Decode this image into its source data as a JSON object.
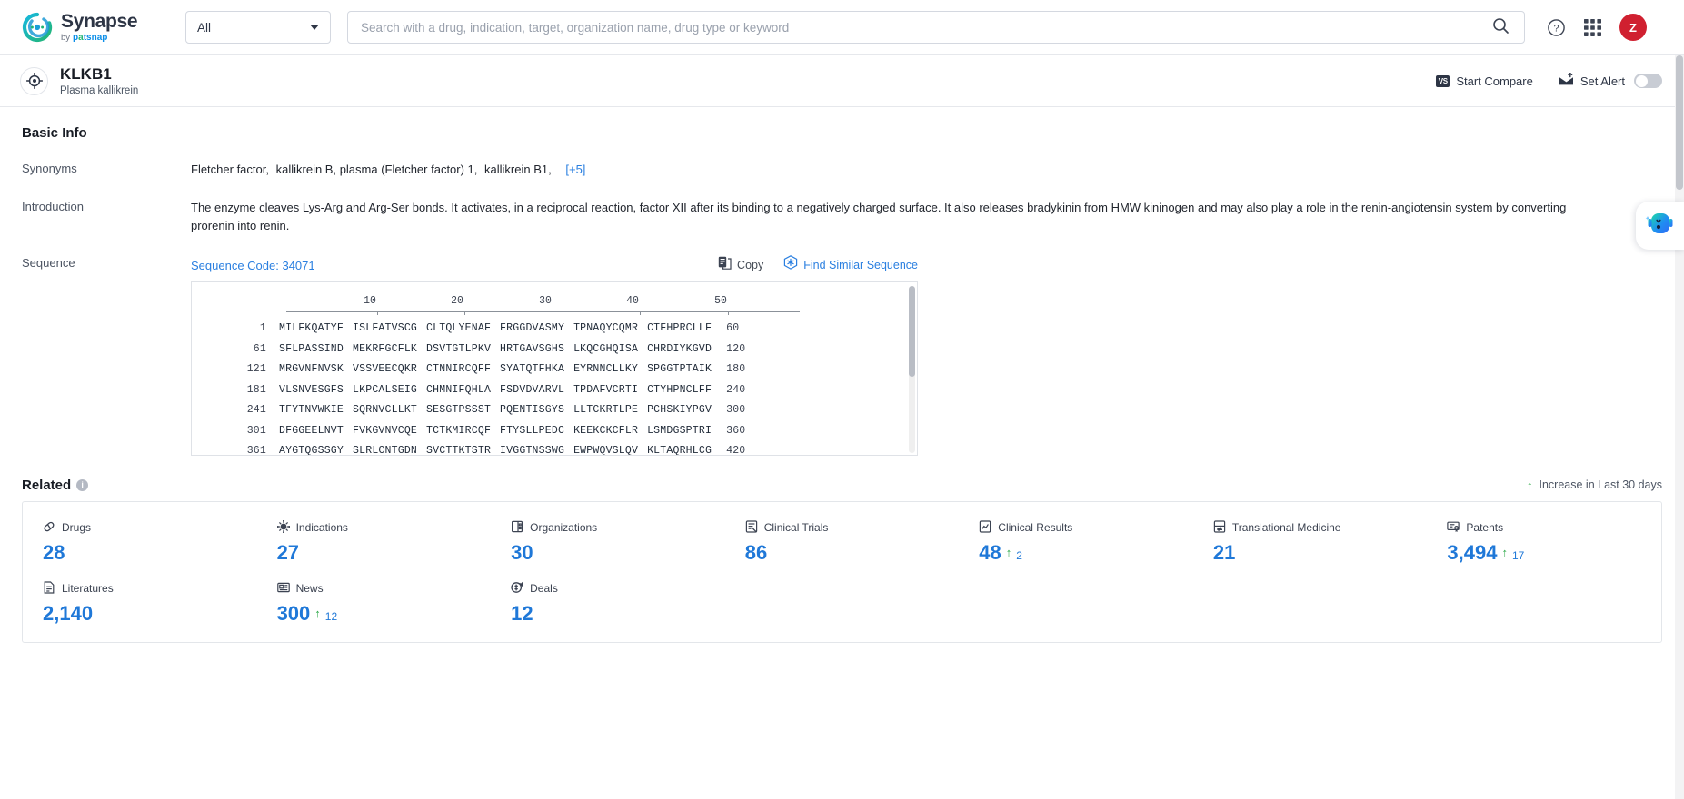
{
  "topbar": {
    "logo": {
      "title": "Synapse",
      "by": "by",
      "brand": "patsnap",
      "icon": "synapse-logo-icon"
    },
    "scope": {
      "value": "All",
      "options": [
        "All"
      ]
    },
    "search": {
      "value": "",
      "placeholder": "Search with a drug, indication, target, organization name, drug type or keyword",
      "icon": "search-icon"
    },
    "help_icon": "help-circle-icon",
    "apps_icon": "apps-grid-icon",
    "avatar_initial": "Z"
  },
  "entitybar": {
    "icon": "target-icon",
    "title": "KLKB1",
    "subtitle": "Plasma kallikrein",
    "start_compare": {
      "label": "Start Compare",
      "badge": "VS",
      "icon": "vs-icon"
    },
    "set_alert": {
      "label": "Set Alert",
      "icon": "alert-mail-icon",
      "enabled": false
    }
  },
  "basic_info": {
    "title": "Basic Info",
    "synonyms": {
      "label": "Synonyms",
      "items": [
        "Fletcher factor,",
        "kallikrein B, plasma (Fletcher factor) 1,",
        "kallikrein B1,"
      ],
      "more": "[+5]"
    },
    "introduction": {
      "label": "Introduction",
      "text": "The enzyme cleaves Lys-Arg and Arg-Ser bonds. It activates, in a reciprocal reaction, factor XII after its binding to a negatively charged surface. It also releases bradykinin from HMW kininogen and may also play a role in the renin-angiotensin system by converting prorenin into renin."
    },
    "sequence": {
      "label": "Sequence",
      "code_label": "Sequence Code: 34071",
      "copy_label": "Copy",
      "copy_icon": "copy-icon",
      "find_label": "Find Similar Sequence",
      "find_icon": "find-similar-icon",
      "ruler_ticks": [
        10,
        20,
        30,
        40,
        50
      ],
      "lines": [
        {
          "start": "1",
          "chunks": [
            "MILFKQATYF",
            "ISLFATVSCG",
            "CLTQLYENAF",
            "FRGGDVASMY",
            "TPNAQYCQMR",
            "CTFHPRCLLF"
          ],
          "end": "60"
        },
        {
          "start": "61",
          "chunks": [
            "SFLPASSIND",
            "MEKRFGCFLK",
            "DSVTGTLPKV",
            "HRTGAVSGHS",
            "LKQCGHQISA",
            "CHRDIYKGVD"
          ],
          "end": "120"
        },
        {
          "start": "121",
          "chunks": [
            "MRGVNFNVSK",
            "VSSVEECQKR",
            "CTNNIRCQFF",
            "SYATQTFHKA",
            "EYRNNCLLKY",
            "SPGGTPTAIK"
          ],
          "end": "180"
        },
        {
          "start": "181",
          "chunks": [
            "VLSNVESGFS",
            "LKPCALSEIG",
            "CHMNIFQHLA",
            "FSDVDVARVL",
            "TPDAFVCRTI",
            "CTYHPNCLFF"
          ],
          "end": "240"
        },
        {
          "start": "241",
          "chunks": [
            "TFYTNVWKIE",
            "SQRNVCLLKT",
            "SESGTPSSST",
            "PQENTISGYS",
            "LLTCKRTLPE",
            "PCHSKIYPGV"
          ],
          "end": "300"
        },
        {
          "start": "301",
          "chunks": [
            "DFGGEELNVT",
            "FVKGVNVCQE",
            "TCTKMIRCQF",
            "FTYSLLPEDC",
            "KEEKCKCFLR",
            "LSMDGSPTRI"
          ],
          "end": "360"
        },
        {
          "start": "361",
          "chunks": [
            "AYGTQGSSGY",
            "SLRLCNTGDN",
            "SVCTTKTSTR",
            "IVGGTNSSWG",
            "EWPWQVSLQV",
            "KLTAQRHLCG"
          ],
          "end": "420"
        }
      ]
    }
  },
  "related": {
    "title": "Related",
    "info_icon": "info-icon",
    "legend": {
      "label": "Increase in Last 30 days",
      "arrow": "↑"
    },
    "items": [
      {
        "label": "Drugs",
        "icon": "drug-capsule-icon",
        "value": "28",
        "delta": ""
      },
      {
        "label": "Indications",
        "icon": "virus-icon",
        "value": "27",
        "delta": ""
      },
      {
        "label": "Organizations",
        "icon": "building-icon",
        "value": "30",
        "delta": ""
      },
      {
        "label": "Clinical Trials",
        "icon": "clinical-trial-icon",
        "value": "86",
        "delta": ""
      },
      {
        "label": "Clinical Results",
        "icon": "clinical-result-icon",
        "value": "48",
        "delta": "2"
      },
      {
        "label": "Translational Medicine",
        "icon": "translational-icon",
        "value": "21",
        "delta": ""
      },
      {
        "label": "Patents",
        "icon": "patent-icon",
        "value": "3,494",
        "delta": "17"
      },
      {
        "label": "Literatures",
        "icon": "literature-icon",
        "value": "2,140",
        "delta": ""
      },
      {
        "label": "News",
        "icon": "news-icon",
        "value": "300",
        "delta": "12"
      },
      {
        "label": "Deals",
        "icon": "deals-icon",
        "value": "12",
        "delta": ""
      }
    ]
  },
  "assistant": {
    "icon": "ai-assistant-icon",
    "label": ""
  }
}
